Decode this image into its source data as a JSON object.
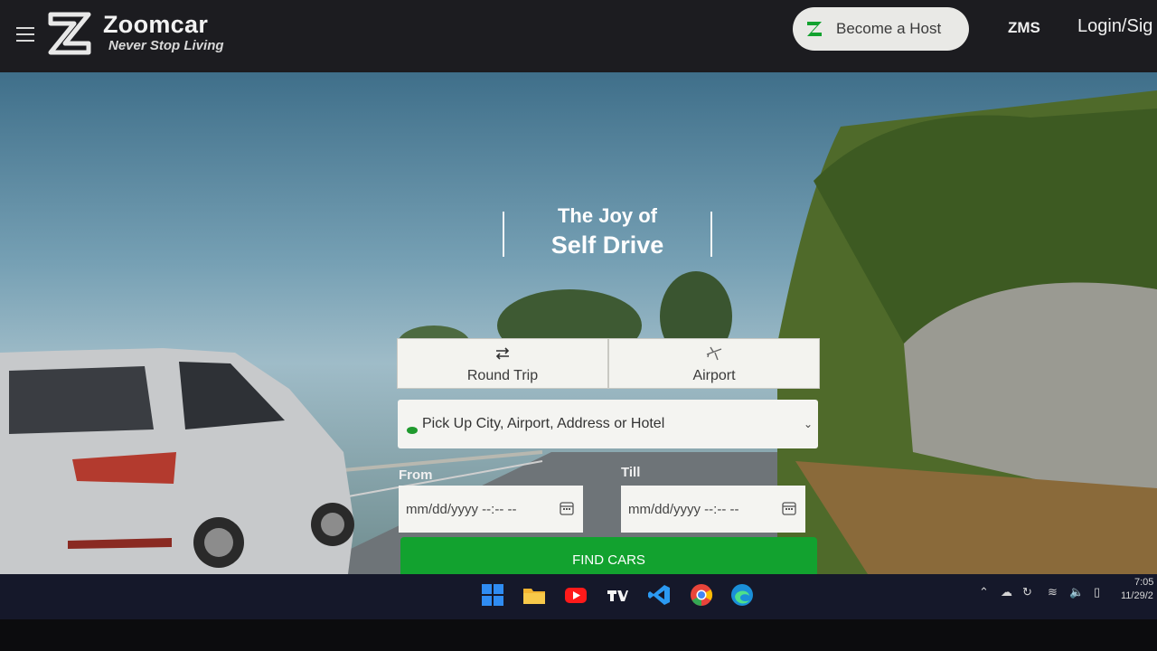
{
  "header": {
    "brand_name": "Zoomcar",
    "brand_tagline": "Never Stop Living",
    "become_host_label": "Become a Host",
    "zms_label": "ZMS",
    "login_label": "Login/Sig"
  },
  "hero": {
    "headline_line1": "The Joy of",
    "headline_line2": "Self Drive"
  },
  "booking": {
    "tabs": [
      {
        "label": "Round Trip",
        "icon": "swap-arrows-icon"
      },
      {
        "label": "Airport",
        "icon": "airplane-icon"
      }
    ],
    "city_placeholder": "Pick Up City, Airport, Address or Hotel",
    "from_label": "From",
    "till_label": "Till",
    "from_value": "mm/dd/yyyy --:-- --",
    "till_value": "mm/dd/yyyy --:-- --",
    "find_button": "FIND CARS"
  },
  "taskbar": {
    "apps": [
      "windows-start-icon",
      "file-explorer-icon",
      "youtube-icon",
      "tradingview-icon",
      "vscode-icon",
      "chrome-icon",
      "edge-icon"
    ],
    "clock_time": "7:05",
    "clock_date": "11/29/2"
  },
  "colors": {
    "accent_green": "#12a22f",
    "header_bg": "#1c1c20",
    "taskbar_bg": "#15182a"
  }
}
